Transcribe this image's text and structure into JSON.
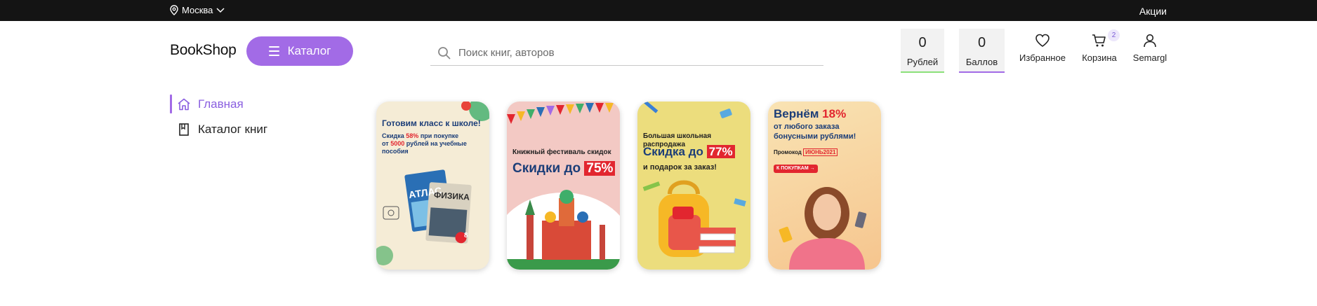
{
  "topbar": {
    "city": "Москва",
    "promo_link": "Акции"
  },
  "header": {
    "logo": "BookShop",
    "catalog_button": "Каталог",
    "search_placeholder": "Поиск книг, авторов",
    "rubles": {
      "value": "0",
      "label": "Рублей"
    },
    "points": {
      "value": "0",
      "label": "Баллов"
    },
    "favorites_label": "Избранное",
    "cart_label": "Корзина",
    "cart_count": "2",
    "user_label": "Semargl"
  },
  "sidebar": {
    "items": [
      {
        "label": "Главная",
        "icon": "home-icon",
        "active": true
      },
      {
        "label": "Каталог книг",
        "icon": "book-icon",
        "active": false
      }
    ]
  },
  "banners": [
    {
      "title": "Готовим класс к школе!",
      "text_a": "Скидка",
      "pct": "58%",
      "text_b": "при покупке",
      "text_c": "от",
      "amount": "5000",
      "text_d": "рублей на учебные",
      "text_e": "пособия",
      "book1": "АТЛАС",
      "book2": "ФИЗИКА",
      "book2_grade": "8"
    },
    {
      "title": "Книжный фестиваль скидок",
      "deal": "Скидки до",
      "pct": "75%"
    },
    {
      "title": "Большая школьная распродажа",
      "deal": "Скидка до",
      "pct": "77%",
      "sub": "и подарок за заказ!"
    },
    {
      "title": "Вернём",
      "pct": "18%",
      "line2": "от любого заказа",
      "line3": "бонусными рублями!",
      "promo_label": "Промокод",
      "promo_code": "ИЮНЬ2021",
      "cta": "К ПОКУПКАМ →"
    }
  ],
  "colors": {
    "accent": "#a26be6",
    "topbar": "#141414",
    "rubles_underline": "#8be07a",
    "banner_red": "#e2262f",
    "banner_navy": "#1c3e78"
  }
}
